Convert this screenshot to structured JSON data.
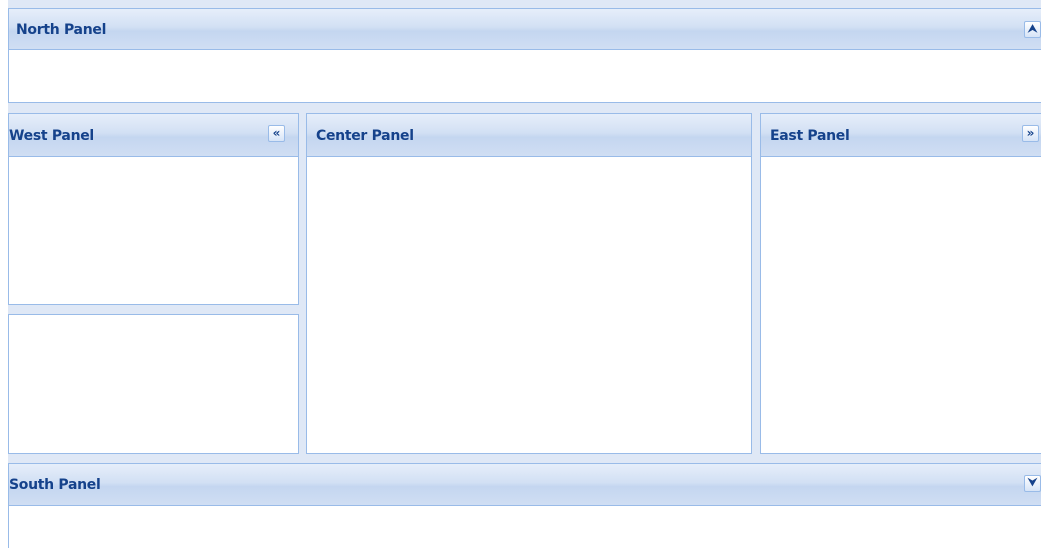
{
  "north": {
    "title": "North Panel",
    "collapse_glyph": "⮝",
    "collapse_icon": "collapse-up-icon"
  },
  "west": {
    "title": "West Panel",
    "collapse_glyph": "«",
    "collapse_icon": "collapse-left-icon"
  },
  "center": {
    "title": "Center Panel"
  },
  "east": {
    "title": "East Panel",
    "collapse_glyph": "»",
    "collapse_icon": "collapse-right-icon"
  },
  "south": {
    "title": "South Panel",
    "collapse_glyph": "⮟",
    "collapse_icon": "collapse-down-icon"
  },
  "colors": {
    "header_text": "#15428b",
    "border": "#99bbe8",
    "layout_background": "#dfe8f6"
  }
}
